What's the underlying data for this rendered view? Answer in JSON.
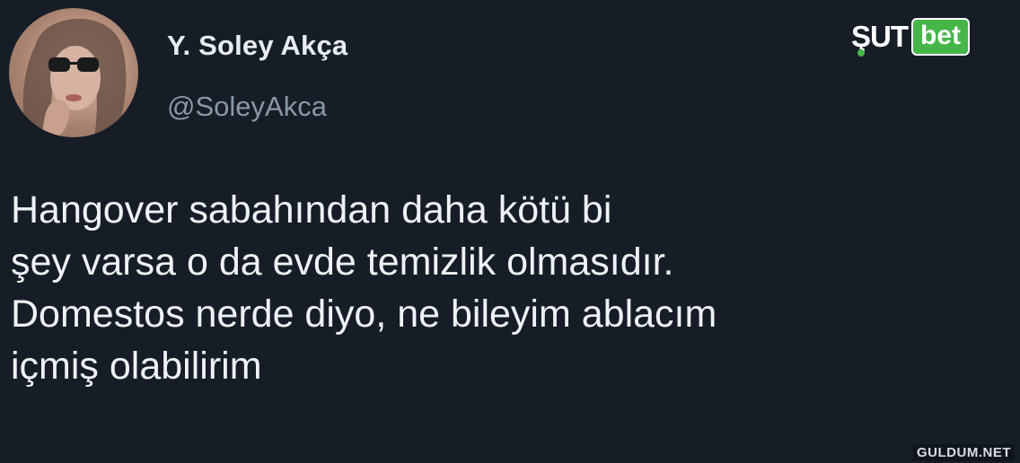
{
  "tweet": {
    "display_name": "Y. Soley Akça",
    "handle": "@SoleyAkca",
    "text_lines": [
      "Hangover sabahından daha kötü bi",
      "şey varsa o da evde temizlik olmasıdır.",
      "Domestos nerde diyo, ne bileyim ablacım",
      "içmiş olabilirim"
    ]
  },
  "brand": {
    "part1": "ŞUT",
    "part2": "bet",
    "accent_color": "#46b649"
  },
  "watermark": "GULDUM.NET",
  "colors": {
    "background": "#161d27",
    "name": "#e8edf2",
    "handle": "#8a97a4",
    "text": "#eef2f5"
  },
  "icons": {
    "avatar": "profile-photo"
  }
}
